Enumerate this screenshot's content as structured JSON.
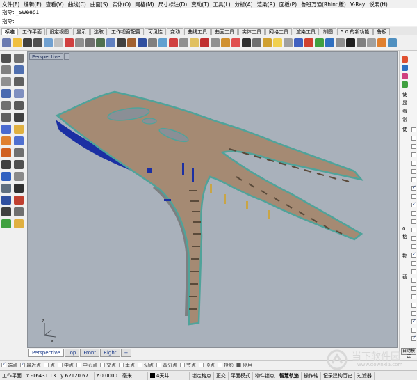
{
  "menu": [
    "文件(F)",
    "编辑(E)",
    "查看(V)",
    "曲线(C)",
    "曲面(S)",
    "实体(O)",
    "网格(M)",
    "尺寸标注(D)",
    "变动(T)",
    "工具(L)",
    "分析(A)",
    "渲染(R)",
    "面板(P)",
    "鲁班万通(Rhino版)",
    "V-Ray",
    "说明(H)"
  ],
  "command": {
    "history": "指令: _Sweep1",
    "prompt": "指令:"
  },
  "tabs": [
    "标准",
    "工作平面",
    "设定视图",
    "显示",
    "选取",
    "工作视窗配置",
    "可见性",
    "变动",
    "曲线工具",
    "曲面工具",
    "实体工具",
    "网格工具",
    "渲染工具",
    "制图",
    "5.0 的新功能",
    "鲁板"
  ],
  "viewport": {
    "title": "Perspective",
    "axis_z": "z",
    "axis_x": "x"
  },
  "viewport_tabs": [
    "Perspective",
    "Top",
    "Front",
    "Right",
    "+"
  ],
  "right_panel": {
    "labels": [
      "使",
      "显",
      "看",
      "常",
      "使",
      "格",
      "0",
      "物",
      "截"
    ],
    "button": "自动模式"
  },
  "osnaps": [
    {
      "label": "端点",
      "checked": true
    },
    {
      "label": "最近点",
      "checked": true
    },
    {
      "label": "点",
      "checked": false
    },
    {
      "label": "中点",
      "checked": false
    },
    {
      "label": "中心点",
      "checked": false
    },
    {
      "label": "交点",
      "checked": false
    },
    {
      "label": "垂点",
      "checked": false
    },
    {
      "label": "切点",
      "checked": false
    },
    {
      "label": "四分点",
      "checked": false
    },
    {
      "label": "节点",
      "checked": false
    },
    {
      "label": "顶点",
      "checked": false
    },
    {
      "label": "投影",
      "checked": false
    },
    {
      "label": "停用",
      "checked": false
    }
  ],
  "status": {
    "cplane": "工作平面",
    "x": "x -16431.13",
    "y": "y 62120.671",
    "z": "z 0.0000",
    "units": "毫米",
    "layer": "4天井",
    "grid_snap": "锁定格点",
    "ortho": "正交",
    "planar": "平面模式",
    "object_snap": "物件锁点",
    "smart_track": "智慧轨迹",
    "gumball": "操作轴",
    "history": "记录建构历史",
    "filter": "过滤器"
  },
  "watermark": {
    "name": "当下软件园",
    "url": "www.downxia.com"
  },
  "colors": {
    "viewport_bg": "#a9b1bb",
    "road": "#a58a73",
    "road_edge": "#4fa39a",
    "barrier": "#1b2fa3",
    "railing": "#7d7f80"
  }
}
